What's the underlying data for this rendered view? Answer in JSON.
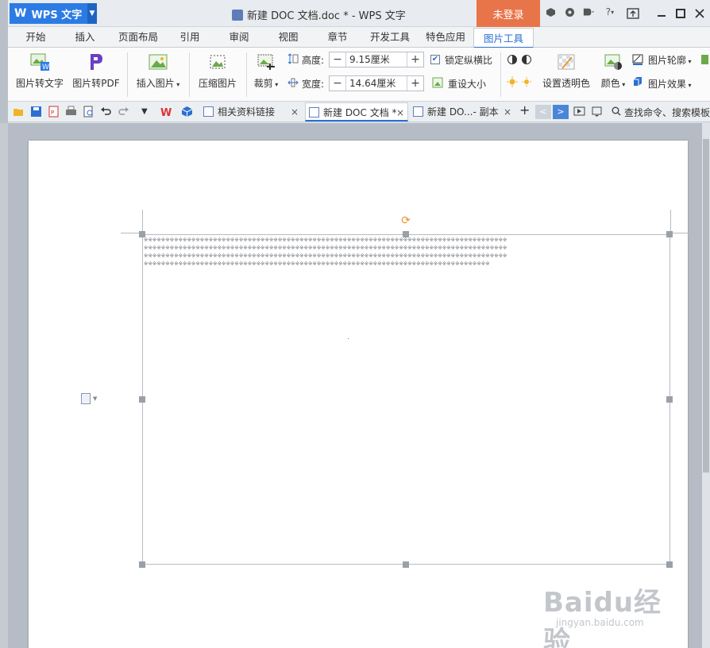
{
  "titlebar": {
    "app_name": "WPS 文字",
    "doc_title": "新建 DOC 文档.doc * - WPS 文字",
    "login": "未登录",
    "help": "?"
  },
  "tabs": [
    "开始",
    "插入",
    "页面布局",
    "引用",
    "审阅",
    "视图",
    "章节",
    "开发工具",
    "特色应用",
    "图片工具"
  ],
  "ribbon": {
    "pic_to_text": "图片转文字",
    "pic_to_pdf": "图片转PDF",
    "insert_pic": "插入图片",
    "compress_pic": "压缩图片",
    "crop": "裁剪",
    "height_label": "高度:",
    "height_value": "9.15厘米",
    "width_label": "宽度:",
    "width_value": "14.64厘米",
    "lock_ratio": "锁定纵横比",
    "reset_size": "重设大小",
    "set_transparent": "设置透明色",
    "color": "颜色",
    "pic_outline": "图片轮廓",
    "pic_effect": "图片效果",
    "minus": "−",
    "plus": "+"
  },
  "doc_tabs": [
    {
      "label": "相关资料链接",
      "close": "×"
    },
    {
      "label": "新建 DOC 文档 *",
      "close": "×"
    },
    {
      "label": "新建 DO...- 副本",
      "close": "×"
    }
  ],
  "qbar": {
    "add_tab": "+",
    "search": "查找命令、搜索模板"
  },
  "document": {
    "garbled_lines": [
      "※※※※※※※※※※※※※※※※※※※※※※※※※※※※※※※※※※※※※※※※※※※※※※※※※※※※※※※※※※※※※※※※※※※※※※※※※※※※※※※※※※※※",
      "※※※※※※※※※※※※※※※※※※※※※※※※※※※※※※※※※※※※※※※※※※※※※※※※※※※※※※※※※※※※※※※※※※※※※※※※※※※※※※※※※※※※",
      "※※※※※※※※※※※※※※※※※※※※※※※※※※※※※※※※※※※※※※※※※※※※※※※※※※※※※※※※※※※※※※※※※※※※※※※※※※※※※※※※※※※※",
      "※※※※※※※※※※※※※※※※※※※※※※※※※※※※※※※※※※※※※※※※※※※※※※※※※※※※※※※※※※※※※※※※※※※※※※※※※※※※※※※※"
    ]
  },
  "watermark": {
    "brand": "Baidu经验",
    "url": "jingyan.baidu.com"
  }
}
